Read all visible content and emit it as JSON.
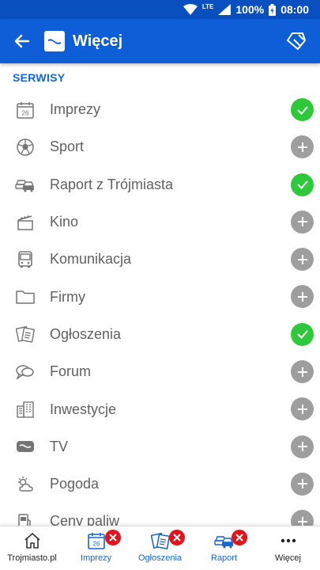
{
  "status_bar": {
    "network": "LTE",
    "battery": "100%",
    "time": "08:00"
  },
  "app_bar": {
    "title": "Więcej"
  },
  "section": {
    "title": "SERWISY"
  },
  "services": [
    {
      "label": "Imprezy",
      "icon": "calendar-icon",
      "enabled": true
    },
    {
      "label": "Sport",
      "icon": "soccer-ball-icon",
      "enabled": false
    },
    {
      "label": "Raport z Trójmiasta",
      "icon": "cars-icon",
      "enabled": true
    },
    {
      "label": "Kino",
      "icon": "clapperboard-icon",
      "enabled": false
    },
    {
      "label": "Komunikacja",
      "icon": "bus-icon",
      "enabled": false
    },
    {
      "label": "Firmy",
      "icon": "folder-icon",
      "enabled": false
    },
    {
      "label": "Ogłoszenia",
      "icon": "notes-icon",
      "enabled": true
    },
    {
      "label": "Forum",
      "icon": "chat-bubbles-icon",
      "enabled": false
    },
    {
      "label": "Inwestycje",
      "icon": "buildings-icon",
      "enabled": false
    },
    {
      "label": "TV",
      "icon": "tv-icon",
      "enabled": false
    },
    {
      "label": "Pogoda",
      "icon": "weather-icon",
      "enabled": false
    },
    {
      "label": "Ceny paliw",
      "icon": "fuel-pump-icon",
      "enabled": false
    }
  ],
  "calendar_day": "26",
  "bottom_nav": [
    {
      "label": "Trojmiasto.pl",
      "icon": "home-icon"
    },
    {
      "label": "Imprezy",
      "icon": "calendar-icon"
    },
    {
      "label": "Ogłoszenia",
      "icon": "notes-icon"
    },
    {
      "label": "Raport",
      "icon": "cars-icon"
    },
    {
      "label": "Więcej",
      "icon": "more-dots-icon"
    }
  ],
  "colors": {
    "primary": "#0e5ed8",
    "status_bar": "#0a4fbf",
    "enabled": "#2ec93a",
    "disabled": "#9e9e9e",
    "remove": "#e1141e"
  }
}
